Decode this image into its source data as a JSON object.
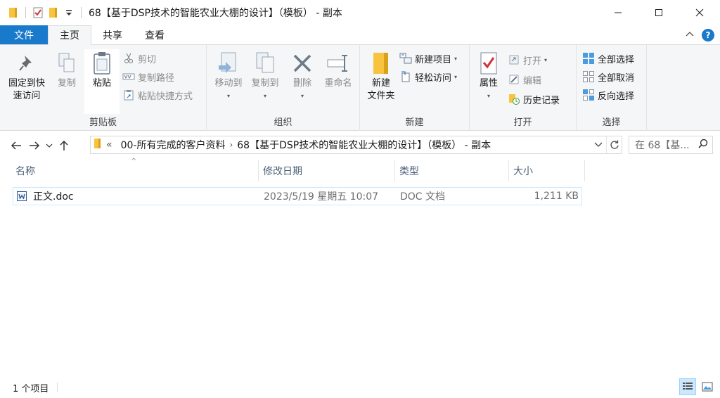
{
  "window": {
    "title": "68【基于DSP技术的智能农业大棚的设计】（模板） - 副本",
    "controls": {
      "minimize": "minimize-icon",
      "maximize": "maximize-icon",
      "close": "close-icon"
    }
  },
  "ribbon_tabs": {
    "file": "文件",
    "home": "主页",
    "share": "共享",
    "view": "查看"
  },
  "ribbon": {
    "clipboard": {
      "label": "剪贴板",
      "pin_line1": "固定到快",
      "pin_line2": "速访问",
      "copy": "复制",
      "paste": "粘贴",
      "cut": "剪切",
      "copy_path": "复制路径",
      "paste_shortcut": "粘贴快捷方式"
    },
    "organize": {
      "label": "组织",
      "move_to": "移动到",
      "copy_to": "复制到",
      "delete": "删除",
      "rename": "重命名"
    },
    "new": {
      "label": "新建",
      "new_folder_line1": "新建",
      "new_folder_line2": "文件夹",
      "new_item": "新建项目",
      "easy_access": "轻松访问"
    },
    "open": {
      "label": "打开",
      "properties": "属性",
      "open": "打开",
      "edit": "编辑",
      "history": "历史记录"
    },
    "select": {
      "label": "选择",
      "select_all": "全部选择",
      "select_none": "全部取消",
      "invert": "反向选择"
    }
  },
  "address_bar": {
    "overflow": "«",
    "crumbs": [
      "00-所有完成的客户资料",
      "68【基于DSP技术的智能农业大棚的设计】（模板） - 副本"
    ],
    "search_placeholder": "在 68【基..."
  },
  "columns": {
    "name": "名称",
    "modified": "修改日期",
    "type": "类型",
    "size": "大小"
  },
  "files": [
    {
      "name": "正文.doc",
      "modified": "2023/5/19 星期五 10:07",
      "type": "DOC 文档",
      "size": "1,211 KB",
      "icon": "word-doc-icon"
    }
  ],
  "status": {
    "count": "1 个项目"
  },
  "colors": {
    "accent": "#1979ca",
    "ribbon_bg": "#f5f6f7",
    "selection_border": "#cce8ff",
    "folder": "#f8c440"
  }
}
